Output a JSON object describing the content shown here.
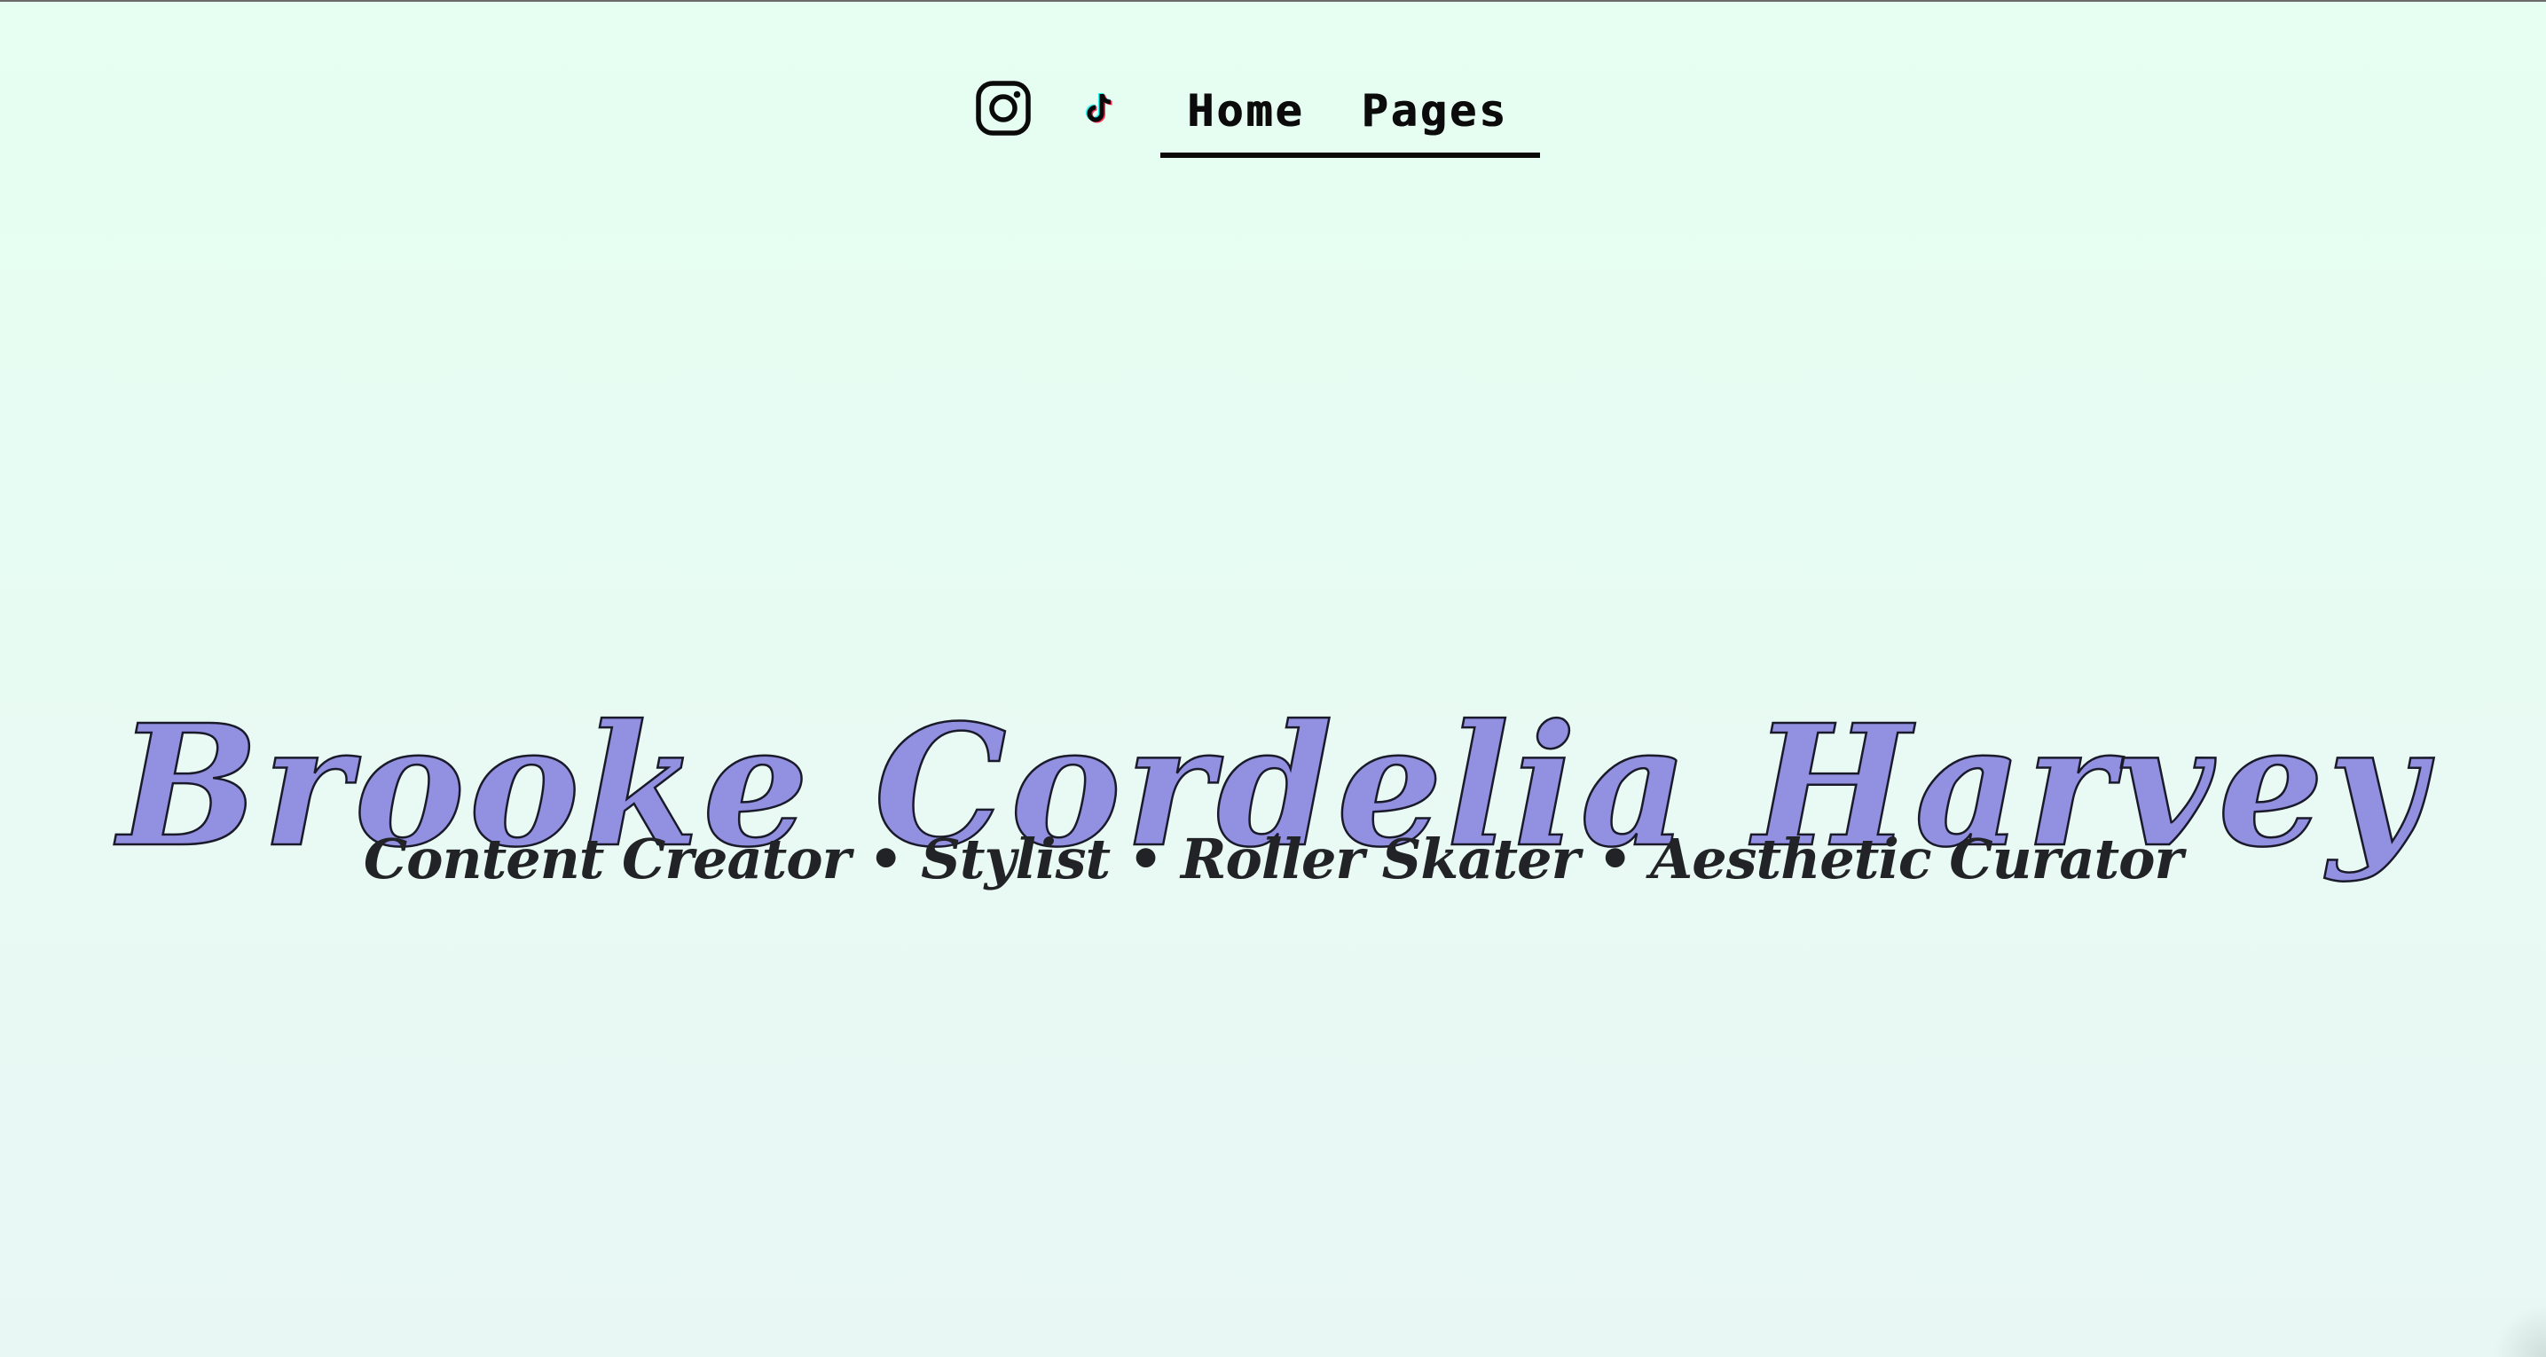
{
  "nav": {
    "social": [
      {
        "name": "Instagram",
        "icon": "instagram-icon"
      },
      {
        "name": "TikTok",
        "icon": "tiktok-icon"
      }
    ],
    "menu": [
      {
        "label": "Home"
      },
      {
        "label": "Pages"
      }
    ]
  },
  "hero": {
    "title": "Brooke Cordelia Harvey",
    "subtitle": "Content Creator • Stylist • Roller Skater • Aesthetic Curator"
  },
  "colors": {
    "background": "#e6fff2",
    "title_fill": "#9290e0",
    "title_outline": "#1a1a2a",
    "subtitle": "#222326",
    "nav_text": "#0b0b0b",
    "tiktok_cyan": "#25f4ee",
    "tiktok_red": "#fe2c55"
  }
}
